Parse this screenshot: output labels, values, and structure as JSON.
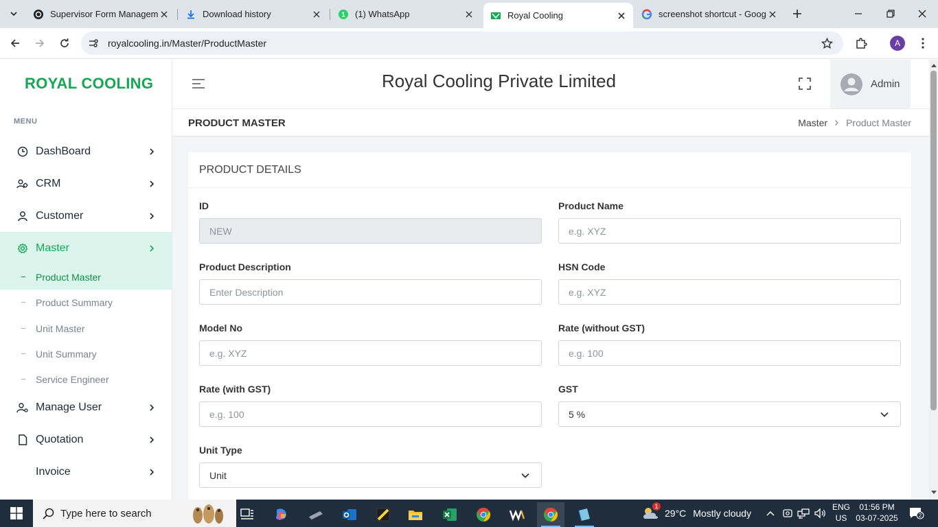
{
  "browser": {
    "tabs": [
      {
        "title": "Supervisor Form Manageme",
        "icon": "supervisor-favicon"
      },
      {
        "title": "Download history",
        "icon": "download-icon"
      },
      {
        "title": "(1) WhatsApp",
        "icon": "whatsapp-icon"
      },
      {
        "title": "Royal Cooling",
        "icon": "royal-cooling-favicon",
        "active": true
      },
      {
        "title": "screenshot shortcut - Googl",
        "icon": "google-icon"
      }
    ],
    "url": "royalcooling.in/Master/ProductMaster",
    "profile_initial": "A"
  },
  "sidebar": {
    "logo": "ROYAL COOLING",
    "menu_label": "MENU",
    "items": [
      {
        "label": "DashBoard",
        "icon": "dashboard-icon"
      },
      {
        "label": "CRM",
        "icon": "crm-icon"
      },
      {
        "label": "Customer",
        "icon": "customer-icon"
      },
      {
        "label": "Master",
        "icon": "gear-icon",
        "active": true
      },
      {
        "label": "Manage User",
        "icon": "manage-user-icon"
      },
      {
        "label": "Quotation",
        "icon": "document-icon"
      },
      {
        "label": "Invoice",
        "icon": "invoice-icon"
      }
    ],
    "sub_items": [
      {
        "label": "Product Master",
        "active": true
      },
      {
        "label": "Product Summary"
      },
      {
        "label": "Unit Master"
      },
      {
        "label": "Unit Summary"
      },
      {
        "label": "Service Engineer"
      }
    ]
  },
  "header": {
    "company": "Royal Cooling Private Limited",
    "user": "Admin"
  },
  "page": {
    "title": "PRODUCT MASTER",
    "breadcrumb_root": "Master",
    "breadcrumb_current": "Product Master"
  },
  "form": {
    "card_title": "PRODUCT DETAILS",
    "id_label": "ID",
    "id_value": "NEW",
    "product_name_label": "Product Name",
    "product_name_placeholder": "e.g. XYZ",
    "description_label": "Product Description",
    "description_placeholder": "Enter Description",
    "hsn_label": "HSN Code",
    "hsn_placeholder": "e.g. XYZ",
    "model_label": "Model No",
    "model_placeholder": "e.g. XYZ",
    "rate_wo_gst_label": "Rate (without GST)",
    "rate_wo_gst_placeholder": "e.g. 100",
    "rate_gst_label": "Rate (with GST)",
    "rate_gst_placeholder": "e.g. 100",
    "gst_label": "GST",
    "gst_value": "5 %",
    "unit_type_label": "Unit Type",
    "unit_type_value": "Unit"
  },
  "taskbar": {
    "search_placeholder": "Type here to search",
    "weather_temp": "29°C",
    "weather_desc": "Mostly cloudy",
    "weather_badge": "1",
    "lang_line1": "ENG",
    "lang_line2": "US",
    "time": "01:56 PM",
    "date": "03-07-2025",
    "notification_count": "2"
  },
  "colors": {
    "brand_green": "#15a852",
    "active_bg": "#dbf5ec",
    "taskbar": "#1f2d3d"
  }
}
